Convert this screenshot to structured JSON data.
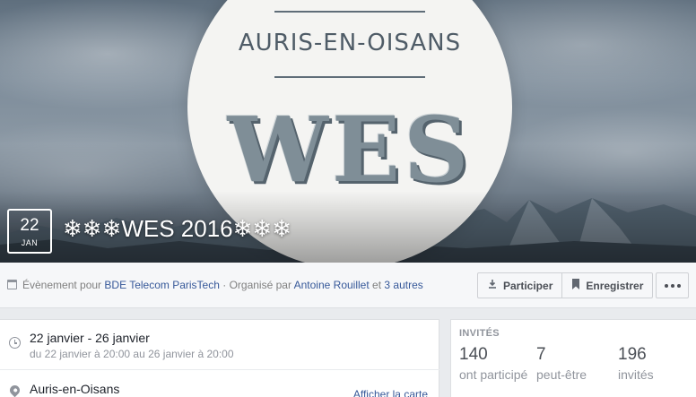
{
  "cover": {
    "logo_subtitle": "AURIS-EN-OISANS",
    "logo_big": "WES"
  },
  "event": {
    "date_day": "22",
    "date_month": "JAN",
    "title": "❄❄❄WES 2016❄❄❄"
  },
  "infobar": {
    "prefix": "Évènement pour",
    "group_link": "BDE Telecom ParisTech",
    "organized_by": "· Organisé par",
    "organizer_link": "Antoine Rouillet",
    "and": "et",
    "others_link": "3 autres"
  },
  "actions": {
    "participate_label": "Participer",
    "save_label": "Enregistrer",
    "more_label": "···"
  },
  "details": {
    "date_range": "22 janvier - 26 janvier",
    "date_detail": "du 22 janvier à 20:00 au 26 janvier à 20:00",
    "location": "Auris-en-Oisans",
    "map_link": "Afficher la carte"
  },
  "invited": {
    "header": "INVITÉS",
    "stats": [
      {
        "value": "140",
        "label": "ont participé"
      },
      {
        "value": "7",
        "label": "peut-être"
      },
      {
        "value": "196",
        "label": "invités"
      }
    ]
  },
  "colors": {
    "link": "#365899",
    "page_bg": "#e9ebee",
    "muted_text": "#90949c"
  },
  "icons": [
    "calendar-icon",
    "participate-icon",
    "bookmark-icon",
    "more-icon",
    "clock-icon",
    "location-pin-icon"
  ]
}
